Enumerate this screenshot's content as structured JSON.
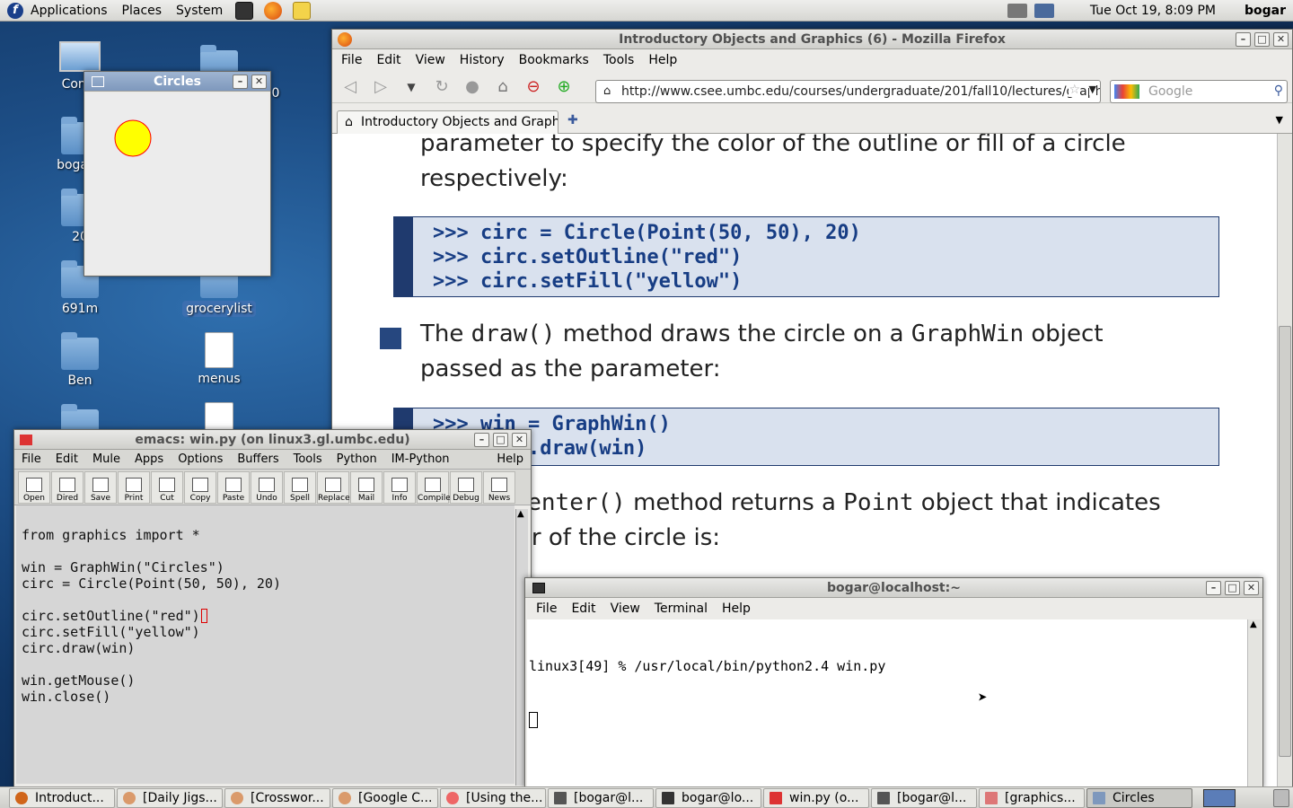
{
  "top_panel": {
    "menus": [
      "Applications",
      "Places",
      "System"
    ],
    "clock": "Tue Oct 19,  8:09 PM",
    "user": "bogar"
  },
  "desktop_icons": [
    {
      "label": "Comp"
    },
    {
      "label": "bogar's"
    },
    {
      "label": "20"
    },
    {
      "label": "691m"
    },
    {
      "label": "Ben"
    },
    {
      "label": "240"
    },
    {
      "label": "grocerylist"
    },
    {
      "label": "menus"
    }
  ],
  "circles_window": {
    "title": "Circles",
    "circle_fill": "#ffff00",
    "circle_outline": "#ff0000"
  },
  "firefox": {
    "title": "Introductory Objects and Graphics (6) - Mozilla Firefox",
    "menu": [
      "File",
      "Edit",
      "View",
      "History",
      "Bookmarks",
      "Tools",
      "Help"
    ],
    "url": "http://www.csee.umbc.edu/courses/undergraduate/201/fall10/lectures/graph",
    "search_placeholder": "Google",
    "tab_label": "Introductory Objects and Graph...",
    "content": {
      "para1_line1": "parameter to specify the color of the outline or fill of a circle",
      "para1_line2": "respectively:",
      "code1": [
        ">>> circ = Circle(Point(50, 50), 20)",
        ">>> circ.setOutline(\"red\")",
        ">>> circ.setFill(\"yellow\")"
      ],
      "para2_pre": "The ",
      "para2_code1": "draw()",
      "para2_mid": " method draws the circle on a ",
      "para2_code2": "GraphWin",
      "para2_post": " object",
      "para2_line2": "passed as the parameter:",
      "code2": [
        ">>> win = GraphWin()",
        ">>> circ.draw(win)"
      ],
      "para3_code1": "getCenter()",
      "para3_mid": " method returns a ",
      "para3_code2": "Point",
      "para3_post": " object that indicates",
      "para3_line2": "the center of the circle is:"
    },
    "accent": "#1f3a6e"
  },
  "emacs": {
    "title": "emacs: win.py (on linux3.gl.umbc.edu)",
    "menu": [
      "File",
      "Edit",
      "Mule",
      "Apps",
      "Options",
      "Buffers",
      "Tools",
      "Python",
      "IM-Python"
    ],
    "help": "Help",
    "tools": [
      "Open",
      "Dired",
      "Save",
      "Print",
      "Cut",
      "Copy",
      "Paste",
      "Undo",
      "Spell",
      "Replace",
      "Mail",
      "Info",
      "Compile",
      "Debug",
      "News"
    ],
    "code_lines": [
      "from graphics import *",
      "",
      "win = GraphWin(\"Circles\")",
      "circ = Circle(Point(50, 50), 20)",
      "",
      "circ.setOutline(\"red\")",
      "circ.setFill(\"yellow\")",
      "circ.draw(win)",
      "",
      "win.getMouse()",
      "win.close()"
    ]
  },
  "terminal": {
    "title": "bogar@localhost:~",
    "menu": [
      "File",
      "Edit",
      "View",
      "Terminal",
      "Help"
    ],
    "line1": "linux3[49] % /usr/local/bin/python2.4 win.py"
  },
  "taskbar": [
    {
      "label": "Introduct...",
      "active": false
    },
    {
      "label": "[Daily Jigs...",
      "active": false
    },
    {
      "label": "[Crosswor...",
      "active": false
    },
    {
      "label": "[Google C...",
      "active": false
    },
    {
      "label": "[Using the...",
      "active": false
    },
    {
      "label": "[bogar@l...",
      "active": false
    },
    {
      "label": "bogar@lo...",
      "active": false
    },
    {
      "label": "win.py (o...",
      "active": false
    },
    {
      "label": "[bogar@l...",
      "active": false
    },
    {
      "label": "[graphics...",
      "active": false
    },
    {
      "label": "Circles",
      "active": true
    }
  ]
}
